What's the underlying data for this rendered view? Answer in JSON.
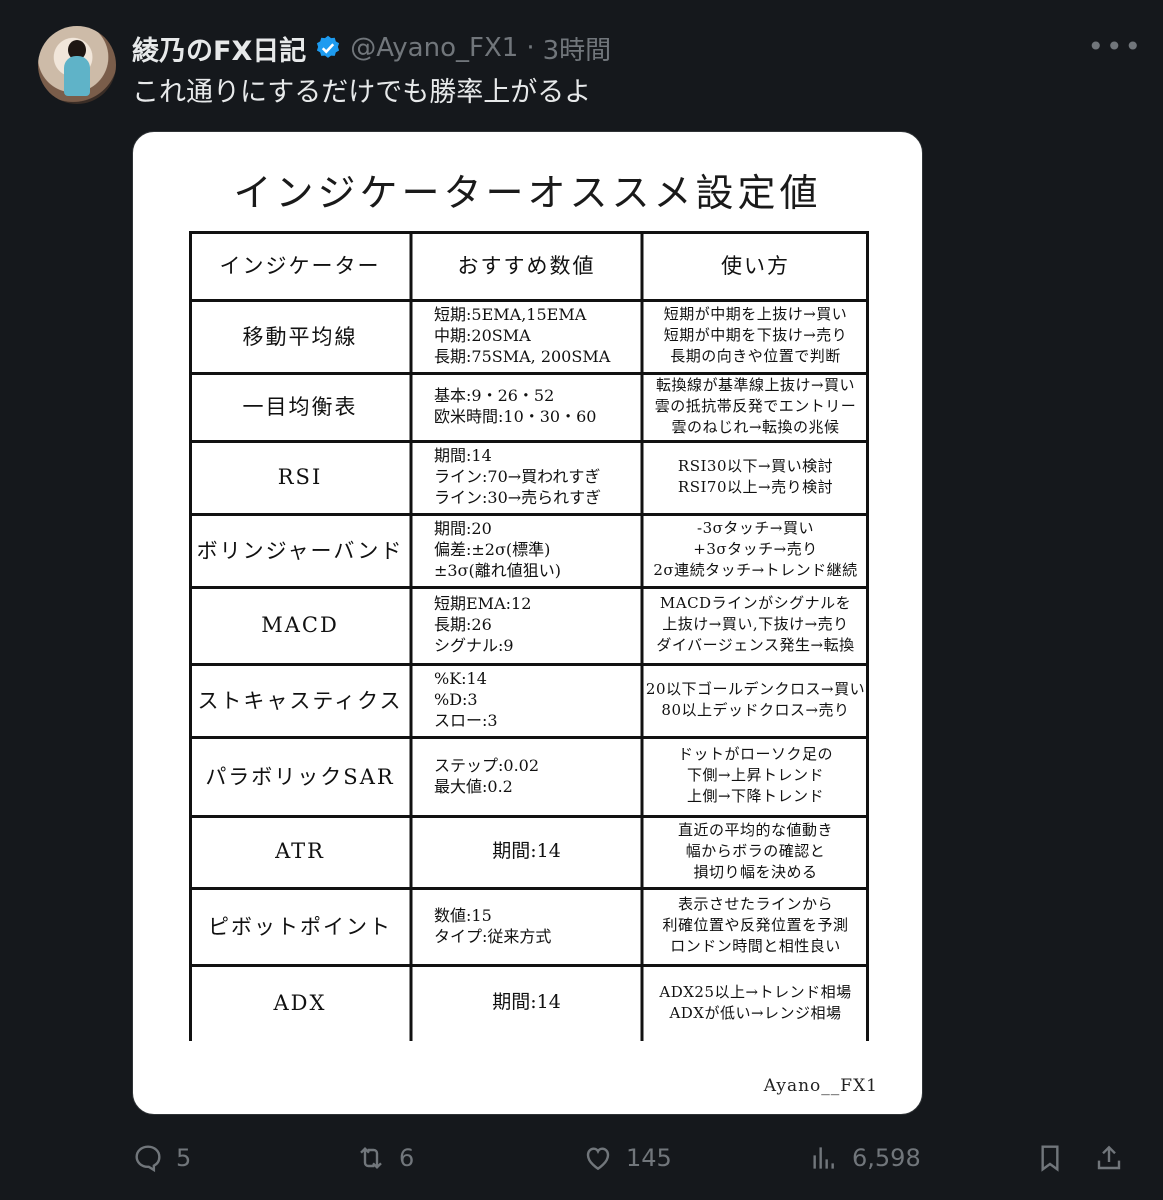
{
  "author": {
    "name": "綾乃のFX日記",
    "handle": "@Ayano_FX1",
    "sep": "·",
    "time": "3時間"
  },
  "tweet": {
    "text": "これ通りにするだけでも勝率上がるよ"
  },
  "card": {
    "title": "インジケーターオススメ設定値",
    "headers": [
      "インジケーター",
      "おすすめ数値",
      "使い方"
    ],
    "rows": [
      {
        "name": "移動平均線",
        "value": "短期:5EMA,15EMA\n中期:20SMA\n長期:75SMA, 200SMA",
        "usage": "短期が中期を上抜け→買い\n短期が中期を下抜け→売り\n長期の向きや位置で判断"
      },
      {
        "name": "一目均衡表",
        "value": "基本:9・26・52\n欧米時間:10・30・60",
        "usage": "転換線が基準線上抜け→買い\n雲の抵抗帯反発でエントリー\n雲のねじれ→転換の兆候"
      },
      {
        "name": "RSI",
        "value": "期間:14\nライン:70→買われすぎ\nライン:30→売られすぎ",
        "usage": "RSI30以下→買い検討\nRSI70以上→売り検討"
      },
      {
        "name": "ボリンジャーバンド",
        "value": "期間:20\n偏差:±2σ(標準)\n±3σ(離れ値狙い)",
        "usage": "-3σタッチ→買い\n+3σタッチ→売り\n2σ連続タッチ→トレンド継続"
      },
      {
        "name": "MACD",
        "value": "短期EMA:12\n長期:26\nシグナル:9",
        "usage": "MACDラインがシグナルを\n上抜け→買い,下抜け→売り\nダイバージェンス発生→転換"
      },
      {
        "name": "ストキャスティクス",
        "value": "%K:14\n%D:3\nスロー:3",
        "usage": "20以下ゴールデンクロス→買い\n80以上デッドクロス→売り"
      },
      {
        "name": "パラボリックSAR",
        "value": "ステップ:0.02\n最大値:0.2",
        "usage": "ドットがローソク足の\n下側→上昇トレンド\n上側→下降トレンド"
      },
      {
        "name": "ATR",
        "value": "期間:14",
        "usage": "直近の平均的な値動き\n幅からボラの確認と\n損切り幅を決める"
      },
      {
        "name": "ピボットポイント",
        "value": "数値:15\nタイプ:従来方式",
        "usage": "表示させたラインから\n利確位置や反発位置を予測\nロンドン時間と相性良い"
      },
      {
        "name": "ADX",
        "value": "期間:14",
        "usage": "ADX25以上→トレンド相場\nADXが低い→レンジ相場"
      }
    ],
    "watermark": "Ayano__FX1"
  },
  "actions": {
    "replies": "5",
    "reposts": "6",
    "likes": "145",
    "views": "6,598"
  },
  "colors": {
    "background": "#15181c",
    "text": "#e7e9ea",
    "muted": "#71767b",
    "verified": "#1d9bf0"
  },
  "icons": [
    "more-icon",
    "verified-icon",
    "reply-icon",
    "repost-icon",
    "like-icon",
    "views-icon",
    "bookmark-icon",
    "share-icon"
  ]
}
